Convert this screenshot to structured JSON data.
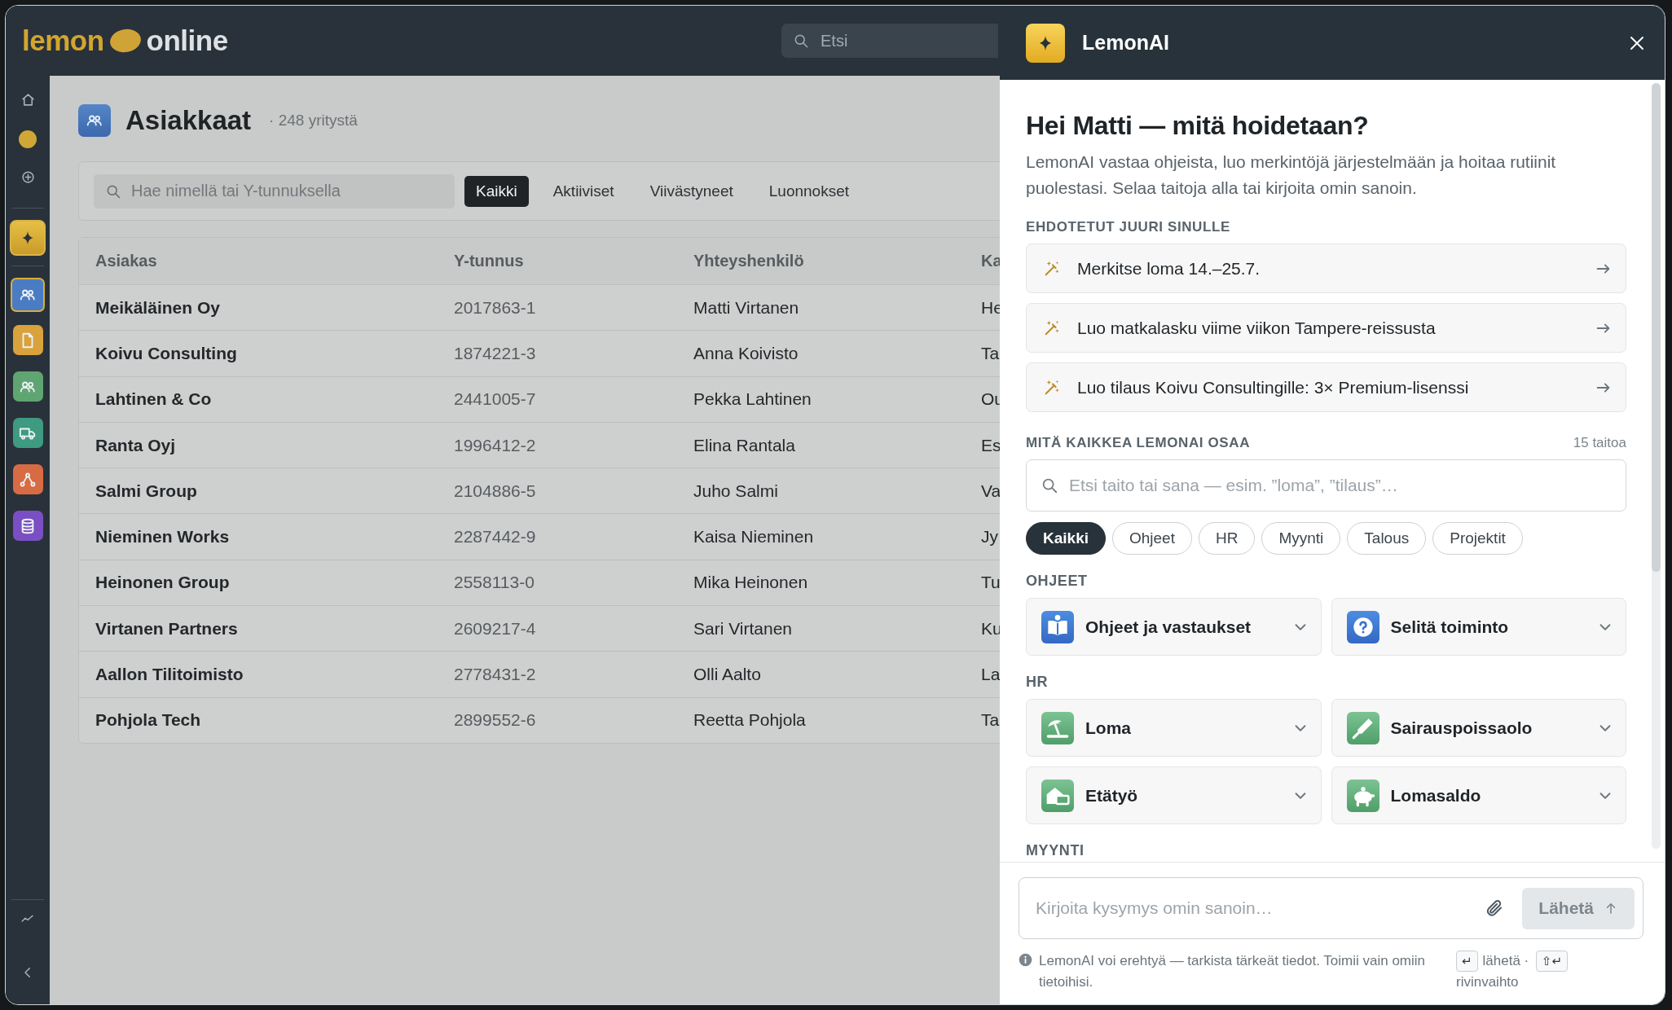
{
  "topbar": {
    "logo": {
      "first_word": "lemon",
      "second_word": "online"
    },
    "search": {
      "placeholder": "Etsi"
    }
  },
  "sidebar": {
    "apps": [
      {
        "color": "#4a7cc4",
        "selected": true
      },
      {
        "color": "#d9a23c",
        "selected": false
      },
      {
        "color": "#5fa571",
        "selected": false
      },
      {
        "color": "#3e9a80",
        "selected": false
      },
      {
        "color": "#d76b43",
        "selected": false
      },
      {
        "color": "#7a4fc3",
        "selected": false
      }
    ]
  },
  "page": {
    "title": "Asiakkaat",
    "count": "· 248 yritystä",
    "filter": {
      "placeholder": "Hae nimellä tai Y-tunnuksella",
      "tabs": [
        {
          "label": "Kaikki",
          "selected": true
        },
        {
          "label": "Aktiiviset",
          "selected": false
        },
        {
          "label": "Viivästyneet",
          "selected": false
        },
        {
          "label": "Luonnokset",
          "selected": false
        }
      ]
    },
    "table": {
      "columns": [
        "Asiakas",
        "Y-tunnus",
        "Yhteyshenkilö",
        "Ka"
      ],
      "rows": [
        [
          "Meikäläinen Oy",
          "2017863-1",
          "Matti Virtanen",
          "He"
        ],
        [
          "Koivu Consulting",
          "1874221-3",
          "Anna Koivisto",
          "Ta"
        ],
        [
          "Lahtinen & Co",
          "2441005-7",
          "Pekka Lahtinen",
          "Ou"
        ],
        [
          "Ranta Oyj",
          "1996412-2",
          "Elina Rantala",
          "Es"
        ],
        [
          "Salmi Group",
          "2104886-5",
          "Juho Salmi",
          "Va"
        ],
        [
          "Nieminen Works",
          "2287442-9",
          "Kaisa Nieminen",
          "Jy"
        ],
        [
          "Heinonen Group",
          "2558113-0",
          "Mika Heinonen",
          "Tu"
        ],
        [
          "Virtanen Partners",
          "2609217-4",
          "Sari Virtanen",
          "Ku"
        ],
        [
          "Aallon Tilitoimisto",
          "2778431-2",
          "Olli Aalto",
          "La"
        ],
        [
          "Pohjola Tech",
          "2899552-6",
          "Reetta Pohjola",
          "Ta"
        ]
      ]
    }
  },
  "panel": {
    "title": "LemonAI",
    "heading": "Hei Matti — mitä hoidetaan?",
    "intro": "LemonAI vastaa ohjeista, luo merkintöjä järjestelmään ja hoitaa rutiinit puolestasi. Selaa taitoja alla tai kirjoita omin sanoin.",
    "suggestions_label": "EHDOTETUT JUURI SINULLE",
    "suggestions": [
      "Merkitse loma 14.–25.7.",
      "Luo matkalasku viime viikon Tampere-reissusta",
      "Luo tilaus Koivu Consultingille: 3× Premium-lisenssi"
    ],
    "skills_label": "MITÄ KAIKKEA LEMONAI OSAA",
    "skills_count": "15 taitoa",
    "search": {
      "placeholder": "Etsi taito tai sana — esim. ”loma”, ”tilaus”…"
    },
    "chips": [
      {
        "label": "Kaikki",
        "selected": true
      },
      {
        "label": "Ohjeet",
        "selected": false
      },
      {
        "label": "HR",
        "selected": false
      },
      {
        "label": "Myynti",
        "selected": false
      },
      {
        "label": "Talous",
        "selected": false
      },
      {
        "label": "Projektit",
        "selected": false
      }
    ],
    "groups": [
      {
        "title": "OHJEET",
        "skills": [
          "Ohjeet ja vastaukset",
          "Selitä toiminto"
        ]
      },
      {
        "title": "HR",
        "skills": [
          "Loma",
          "Sairauspoissaolo",
          "Etätyö",
          "Lomasaldo"
        ]
      },
      {
        "title": "MYYNTI"
      }
    ],
    "composer": {
      "placeholder": "Kirjoita kysymys omin sanoin…",
      "send": {
        "label": "Lähetä",
        "disabled": true
      }
    },
    "note": "LemonAI voi erehtyä — tarkista tärkeät tiedot. Toimii vain omiin tietoihisi.",
    "hints": [
      {
        "key": "↵",
        "label": "lähetä ·"
      },
      {
        "key": "⇧↵",
        "label": "rivinvaihto"
      }
    ]
  }
}
